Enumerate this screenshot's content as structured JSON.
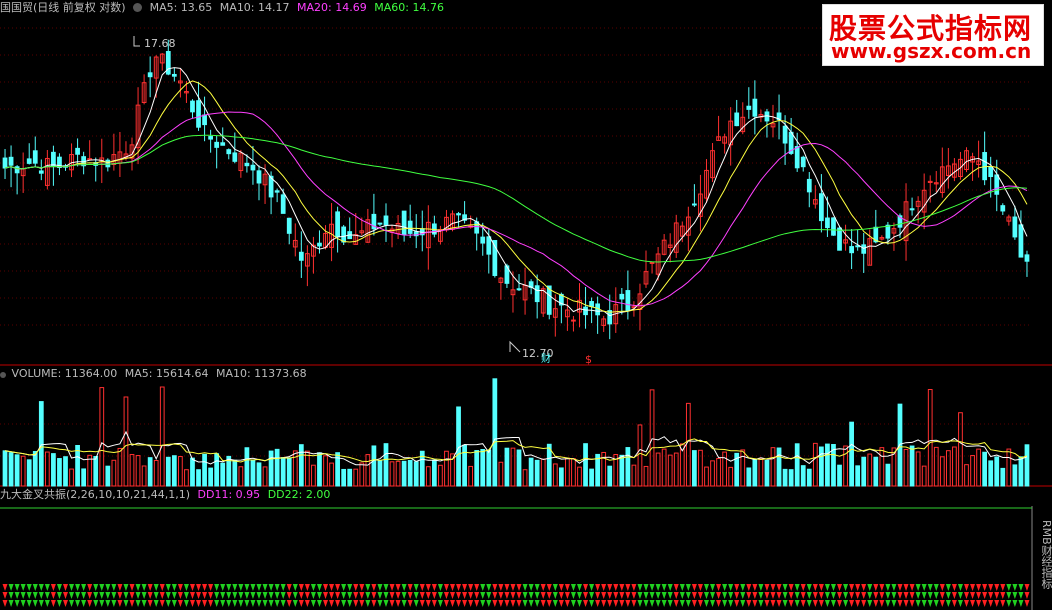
{
  "header": {
    "title": "国国贸(日线 前复权 对数)",
    "ma5_label": "MA5: 13.65",
    "ma10_label": "MA10: 14.17",
    "ma20_label": "MA20: 14.69",
    "ma60_label": "MA60: 14.76"
  },
  "annotations": {
    "high_label": "17.68",
    "low_label": "12.70",
    "fin_marker": "财",
    "dollar_marker": "$"
  },
  "volume": {
    "volume_label": "VOLUME: 11364.00",
    "ma5_label": "MA5: 15614.64",
    "ma10_label": "MA10: 11373.68"
  },
  "indicator": {
    "title": "九大金叉共振(2,26,10,10,21,44,1,1)",
    "dd11_label": "DD11: 0.95",
    "dd22_label": "DD22: 2.00",
    "side_text": "RMB财经指标"
  },
  "watermark": {
    "title": "股票公式指标网",
    "url": "www.gszx.com.cn"
  },
  "colors": {
    "up": "#ff3030",
    "down": "#54ffff",
    "ma5": "#ffffff",
    "ma10": "#ffff40",
    "ma20": "#ff40ff",
    "ma60": "#40ff40",
    "divider": "#c00000",
    "dd_line": "#30d030",
    "arrow_red": "#ff2020",
    "arrow_green": "#20d020"
  },
  "chart_data": {
    "type": "candlestick",
    "price_scale": "log",
    "high": 17.68,
    "low": 12.7,
    "close_path": [
      15.2,
      15.3,
      15.2,
      15.4,
      15.3,
      15.6,
      17.3,
      16.8,
      15.8,
      15.5,
      15.2,
      14.6,
      13.6,
      14.3,
      14.0,
      14.3,
      14.1,
      14.2,
      14.3,
      14.0,
      13.4,
      13.2,
      13.0,
      12.9,
      12.8,
      13.0,
      13.6,
      14.2,
      15.0,
      16.0,
      16.3,
      16.0,
      15.2,
      14.2,
      13.8,
      13.9,
      14.4,
      15.0,
      15.3,
      15.4,
      14.5,
      13.5
    ],
    "ma5": 13.65,
    "ma10": 14.17,
    "ma20": 14.69,
    "ma60": 14.76,
    "volume": 11364.0,
    "volume_ma5": 15614.64,
    "volume_ma10": 11373.68,
    "dd11": 0.95,
    "dd22": 2.0
  }
}
